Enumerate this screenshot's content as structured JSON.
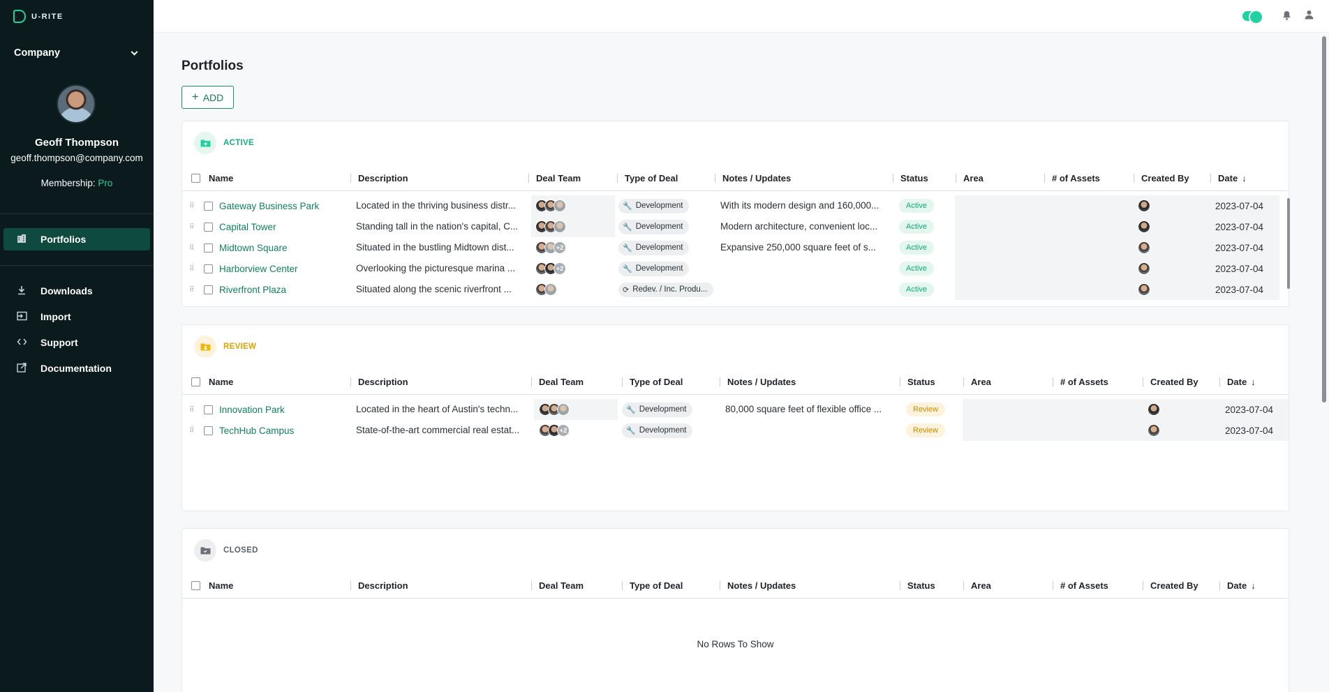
{
  "app": {
    "logo_text": "U-RITE"
  },
  "sidebar": {
    "company": "Company",
    "user": {
      "name": "Geoff Thompson",
      "email": "geoff.thompson@company.com",
      "membership_label": "Membership:",
      "membership_value": "Pro"
    },
    "primary": [
      {
        "label": "Portfolios",
        "icon": "building-icon"
      }
    ],
    "secondary": [
      {
        "label": "Downloads",
        "icon": "download-icon"
      },
      {
        "label": "Import",
        "icon": "import-icon"
      },
      {
        "label": "Support",
        "icon": "code-icon"
      },
      {
        "label": "Documentation",
        "icon": "external-link-icon"
      }
    ]
  },
  "main": {
    "title": "Portfolios",
    "add_label": "ADD",
    "columns": [
      "Name",
      "Description",
      "Deal Team",
      "Type of Deal",
      "Notes / Updates",
      "Status",
      "Area",
      "# of Assets",
      "Created By",
      "Date"
    ],
    "panels": [
      {
        "title": "ACTIVE",
        "rows": [
          {
            "name": "Gateway Business Park",
            "description": "Located in the thriving business distr...",
            "team_extra": "",
            "deal_type": "Development",
            "notes": "With its modern design and 160,000...",
            "status": "Active",
            "date": "2023-07-04"
          },
          {
            "name": "Capital Tower",
            "description": "Standing tall in the nation's capital, C...",
            "team_extra": "",
            "deal_type": "Development",
            "notes": "Modern architecture, convenient loc...",
            "status": "Active",
            "date": "2023-07-04"
          },
          {
            "name": "Midtown Square",
            "description": "Situated in the bustling Midtown dist...",
            "team_extra": "+2",
            "deal_type": "Development",
            "notes": "Expansive 250,000 square feet of s...",
            "status": "Active",
            "date": "2023-07-04"
          },
          {
            "name": "Harborview Center",
            "description": "Overlooking the picturesque marina ...",
            "team_extra": "+2",
            "deal_type": "Development",
            "notes": "",
            "status": "Active",
            "date": "2023-07-04"
          },
          {
            "name": "Riverfront Plaza",
            "description": "Situated along the scenic riverfront ...",
            "team_extra": "",
            "deal_type": "Redev. / Inc. Produ...",
            "notes": "",
            "status": "Active",
            "date": "2023-07-04"
          }
        ]
      },
      {
        "title": "REVIEW",
        "rows": [
          {
            "name": "Innovation Park",
            "description": "Located in the heart of Austin's techn...",
            "team_extra": "",
            "deal_type": "Development",
            "notes": "80,000 square feet of flexible office ...",
            "status": "Review",
            "date": "2023-07-04"
          },
          {
            "name": "TechHub Campus",
            "description": "State-of-the-art commercial real estat...",
            "team_extra": "+2",
            "deal_type": "Development",
            "notes": "",
            "status": "Review",
            "date": "2023-07-04"
          }
        ]
      },
      {
        "title": "CLOSED",
        "empty_text": "No Rows To Show"
      }
    ]
  },
  "colors": {
    "accent": "#1fd3a0",
    "link": "#12805f",
    "active": "#14a877",
    "review": "#c98b00",
    "sidebar": "#0b1a1c"
  }
}
